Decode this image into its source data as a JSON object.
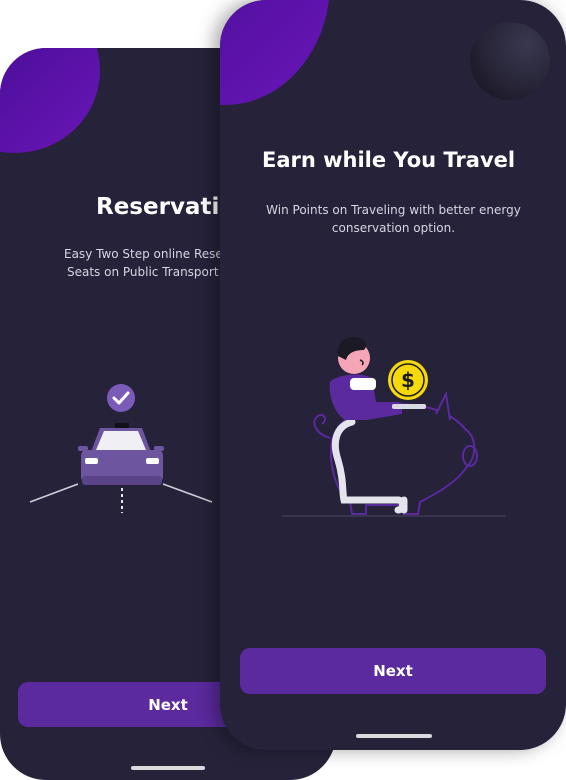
{
  "screens": [
    {
      "title": "Reservatio",
      "subtitle_line1": "Easy Two Step online Reser",
      "subtitle_line2": "Seats on Public Transport",
      "next_label": "Next",
      "illustration": "taxi-check-icon"
    },
    {
      "title": "Earn while You Travel",
      "subtitle_line1": "Win Points on Traveling with better energy",
      "subtitle_line2": "conservation option.",
      "next_label": "Next",
      "illustration": "piggy-bank-coin-icon"
    }
  ],
  "colors": {
    "background": "#25223a",
    "accent": "#5b2a9e",
    "blob": "#4a0f9e",
    "coin": "#f5d90a"
  }
}
